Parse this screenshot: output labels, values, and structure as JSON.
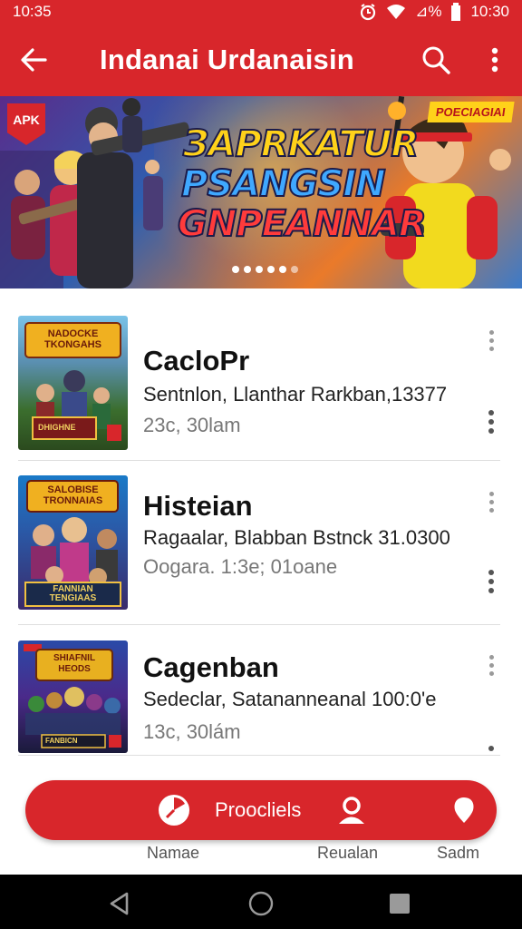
{
  "status": {
    "time_left": "10:35",
    "battery_text": "⊿%",
    "time_right": "10:30"
  },
  "app_bar": {
    "title": "Indanai Urdanaisin"
  },
  "banner": {
    "badge": "APK",
    "promo": "POECIAGIAI",
    "lines": [
      "ЗАРRKATUR",
      "PSANGSIN",
      "GNPEANNAR"
    ],
    "slide_count": 6,
    "active_slide": 0
  },
  "items": [
    {
      "name": "CacloPr",
      "detail": "Sentnlon, Llanthar Rarkban,13377",
      "time": "23c, 30lam",
      "thumb_title": "NADOCKE TKONGAHS",
      "thumb_sub": "DHIGHNE"
    },
    {
      "name": "Histeian",
      "detail": "Ragaalar, Blabban Bstnck 31.0300",
      "time": "Oogara. 1:3e; 01oane",
      "thumb_title": "SALOBISE TRONNAIAS",
      "thumb_sub": "FANNIAN TENGIAAS"
    },
    {
      "name": "Cagenban",
      "detail": "Sedeclar, Satananneanal 100:0'e",
      "time": "13c, 30lám",
      "thumb_title": "SHIAFNIL HEODS",
      "thumb_sub": "FANBICN"
    }
  ],
  "bottom_nav": {
    "pill_label": "Proocliels",
    "labels": [
      "Namae",
      "Reualan",
      "Sadm"
    ]
  },
  "colors": {
    "primary": "#d8262b",
    "text": "#111111",
    "muted": "#777777"
  }
}
